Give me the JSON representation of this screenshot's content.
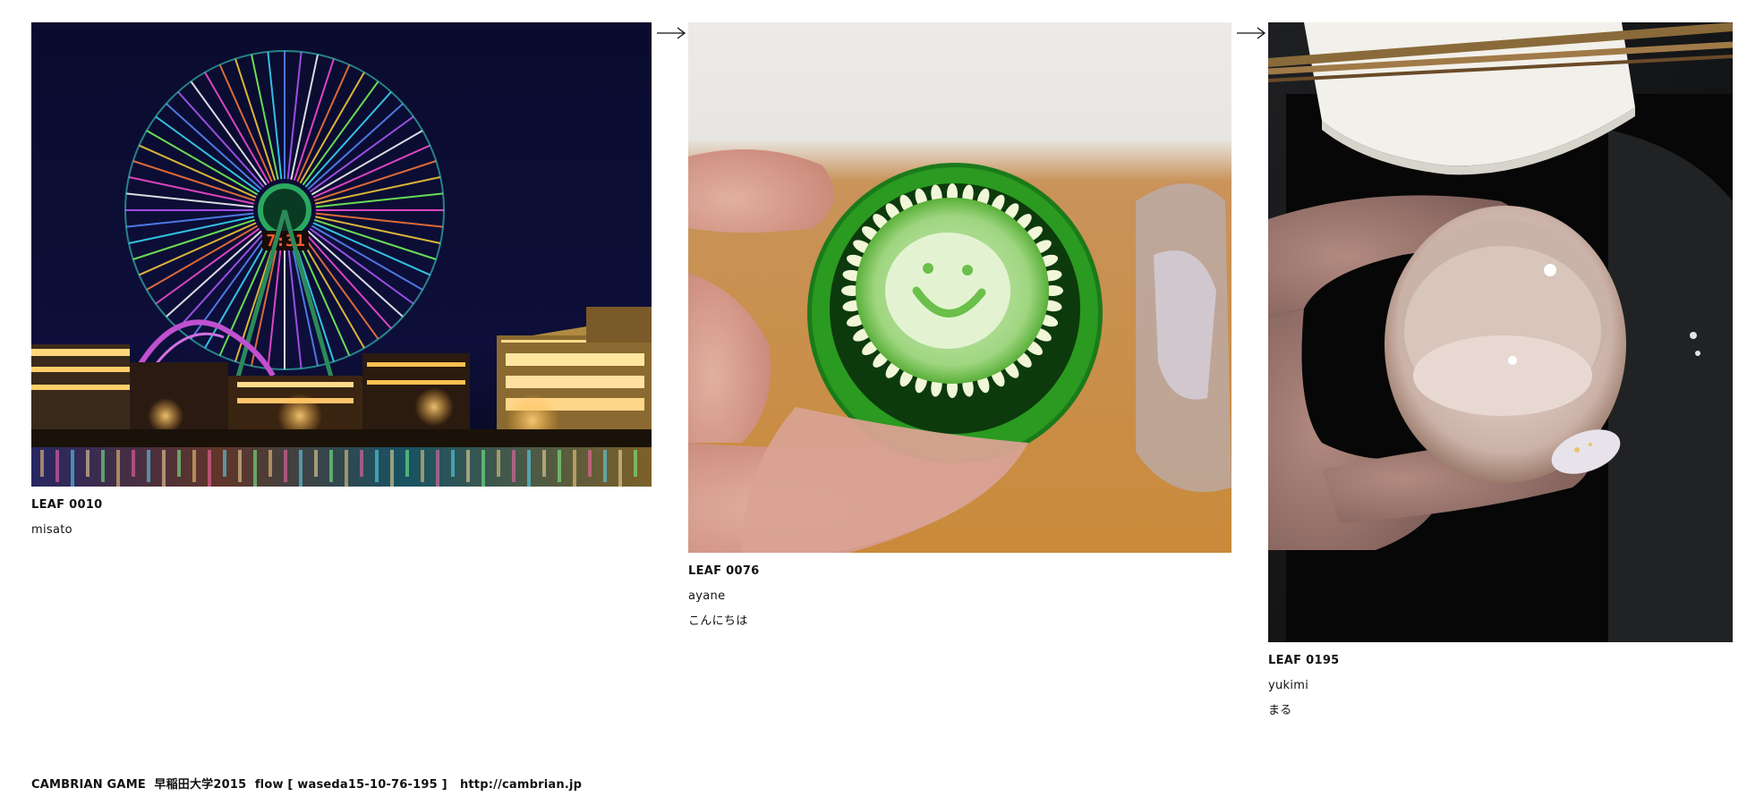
{
  "leaves": [
    {
      "id_label": "LEAF 0010",
      "user": "misato",
      "message": "",
      "photo_subject": "night-ferris-wheel-photo",
      "clock_text": "7:31"
    },
    {
      "id_label": "LEAF 0076",
      "user": "ayane",
      "message": "こんにちは",
      "photo_subject": "cucumber-smiley-photo"
    },
    {
      "id_label": "LEAF 0195",
      "user": "yukimi",
      "message": "まる",
      "photo_subject": "sake-cup-photo"
    }
  ],
  "arrows": [
    "arrow-right-icon",
    "arrow-right-icon"
  ],
  "footer": {
    "brand": "CAMBRIAN GAME",
    "event": "早稲田大学2015",
    "flow": "flow [ waseda15-10-76-195 ]",
    "url": "http://cambrian.jp"
  },
  "colors": {
    "text": "#111111",
    "background": "#ffffff"
  }
}
